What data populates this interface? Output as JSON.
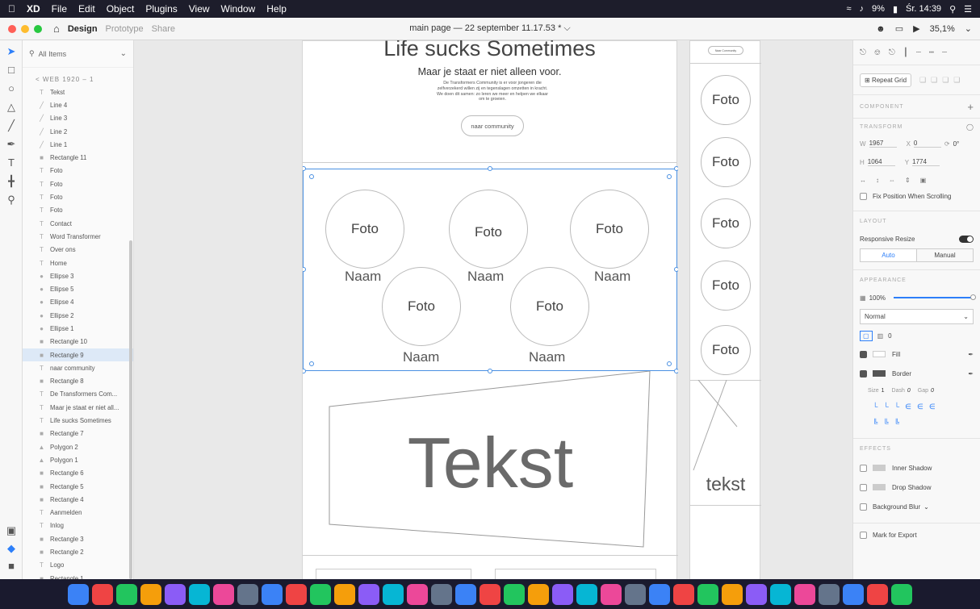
{
  "menubar": {
    "app_name": "XD",
    "items": [
      "File",
      "Edit",
      "Object",
      "Plugins",
      "View",
      "Window",
      "Help"
    ],
    "battery": "9%",
    "clock": "Śr. 14:39"
  },
  "toolbar": {
    "tabs": [
      "Design",
      "Prototype",
      "Share"
    ],
    "active_tab": "Design",
    "doc_title": "main page — 22 september 11.17.53 * ⌵",
    "zoom": "35,1%"
  },
  "layers": {
    "search_placeholder": "All Items",
    "breadcrumb": "< WEB 1920 – 1",
    "items": [
      {
        "label": "Tekst",
        "icon": "T"
      },
      {
        "label": "Line 4",
        "icon": "line"
      },
      {
        "label": "Line 3",
        "icon": "line"
      },
      {
        "label": "Line 2",
        "icon": "line"
      },
      {
        "label": "Line 1",
        "icon": "line"
      },
      {
        "label": "Rectangle 11",
        "icon": "rect"
      },
      {
        "label": "Foto",
        "icon": "T"
      },
      {
        "label": "Foto",
        "icon": "T"
      },
      {
        "label": "Foto",
        "icon": "T"
      },
      {
        "label": "Foto",
        "icon": "T"
      },
      {
        "label": "Contact",
        "icon": "T"
      },
      {
        "label": "Word Transformer",
        "icon": "T"
      },
      {
        "label": "Over ons",
        "icon": "T"
      },
      {
        "label": "Home",
        "icon": "T"
      },
      {
        "label": "Ellipse 3",
        "icon": "ellipse"
      },
      {
        "label": "Ellipse 5",
        "icon": "ellipse"
      },
      {
        "label": "Ellipse 4",
        "icon": "ellipse"
      },
      {
        "label": "Ellipse 2",
        "icon": "ellipse"
      },
      {
        "label": "Ellipse 1",
        "icon": "ellipse"
      },
      {
        "label": "Rectangle 10",
        "icon": "rect"
      },
      {
        "label": "Rectangle 9",
        "icon": "rect",
        "selected": true
      },
      {
        "label": "naar community",
        "icon": "T"
      },
      {
        "label": "Rectangle 8",
        "icon": "rect"
      },
      {
        "label": "De Transformers Com...",
        "icon": "T"
      },
      {
        "label": "Maar je staat er niet all...",
        "icon": "T"
      },
      {
        "label": "Life sucks Sometimes",
        "icon": "T"
      },
      {
        "label": "Rectangle 7",
        "icon": "rect"
      },
      {
        "label": "Polygon 2",
        "icon": "polygon"
      },
      {
        "label": "Polygon 1",
        "icon": "polygon"
      },
      {
        "label": "Rectangle 6",
        "icon": "rect"
      },
      {
        "label": "Rectangle 5",
        "icon": "rect"
      },
      {
        "label": "Rectangle 4",
        "icon": "rect"
      },
      {
        "label": "Aanmelden",
        "icon": "T"
      },
      {
        "label": "Inlog",
        "icon": "T"
      },
      {
        "label": "Rectangle 3",
        "icon": "rect"
      },
      {
        "label": "Rectangle 2",
        "icon": "rect"
      },
      {
        "label": "Logo",
        "icon": "T"
      },
      {
        "label": "Rectangle 1",
        "icon": "rect"
      }
    ]
  },
  "canvas": {
    "hero_title": "Life sucks Sometimes",
    "hero_subtitle": "Maar je staat er niet alleen voor.",
    "hero_paragraph": "De Transformers Community is er voor jongeren die zelfverzekerd willen zij en tegenslagen omzetten in kracht. We doen dit samen: zo leren we meer en helpen we elkaar om te groeien.",
    "cta_label": "naar community",
    "foto_label": "Foto",
    "naam_label": "Naam",
    "big_text": "Tekst",
    "side_button": "Naar Community",
    "side_text": "tekst"
  },
  "inspector": {
    "repeat_grid": "Repeat Grid",
    "component_header": "COMPONENT",
    "transform_header": "TRANSFORM",
    "w_label": "W",
    "w_value": "1967",
    "x_label": "X",
    "x_value": "0",
    "rotation": "0°",
    "h_label": "H",
    "h_value": "1064",
    "y_label": "Y",
    "y_value": "1774",
    "fix_position": "Fix Position When Scrolling",
    "layout_header": "LAYOUT",
    "responsive_resize": "Responsive Resize",
    "auto_label": "Auto",
    "manual_label": "Manual",
    "appearance_header": "APPEARANCE",
    "opacity": "100%",
    "blend_mode": "Normal",
    "corner_radius": "0",
    "fill_label": "Fill",
    "border_label": "Border",
    "size_label": "Size",
    "size_value": "1",
    "dash_label": "Dash",
    "dash_value": "0",
    "gap_label": "Gap",
    "gap_value": "0",
    "effects_header": "EFFECTS",
    "inner_shadow": "Inner Shadow",
    "drop_shadow": "Drop Shadow",
    "background_blur": "Background Blur",
    "mark_export": "Mark for Export"
  },
  "colors": {
    "selection": "#4a90e2",
    "menubar": "#1d1d2b",
    "dock": "#1a1a2e"
  },
  "dock_apps": [
    "finder",
    "launchpad",
    "safari",
    "chrome",
    "preview",
    "facetime",
    "finder2",
    "photos",
    "notes",
    "spotify",
    "messenger",
    "discord",
    "xcode",
    "steam",
    "movie",
    "settings",
    "teams",
    "powerpoint",
    "word",
    "edge",
    "outlook",
    "vscode",
    "illustrator",
    "photoshop",
    "preview2",
    "finder3",
    "terminal",
    "filezilla",
    "mail",
    "epic",
    "roblox",
    "fire",
    "excel",
    "xd",
    "trash"
  ]
}
